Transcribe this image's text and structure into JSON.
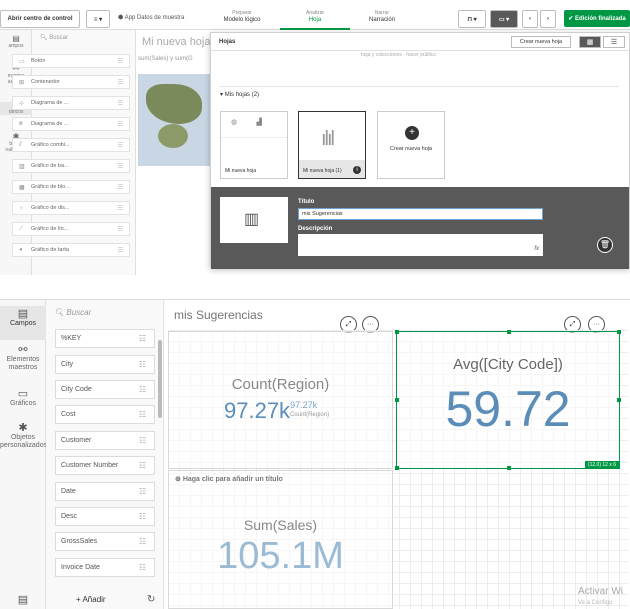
{
  "toolbar": {
    "hub_button": "Abrir centro de control",
    "app_name": "App Datos de muestra",
    "modes": [
      {
        "small": "Preparar",
        "main": "Modelo lógico"
      },
      {
        "small": "Analizar",
        "main": "Hoja"
      },
      {
        "small": "Narrar",
        "main": "Narración"
      }
    ],
    "done_button": "Edición finalizada"
  },
  "left_icons_top": [
    "ampos",
    "mentos aestros",
    "ráficos",
    "bjetos nalizados"
  ],
  "assets_top": {
    "search_placeholder": "Buscar",
    "items": [
      "Botón",
      "Contenedor",
      "Diagrama de ...",
      "Diagrama de ...",
      "Gráfico combi...",
      "Gráfico de ba...",
      "Gráfico de blo...",
      "Gráfico de dis...",
      "Gráfico de lín...",
      "Gráfico de tarta"
    ]
  },
  "bg_sheet": {
    "title": "Mi nueva hoja",
    "subtitle": "sum(Sales) y sum(G"
  },
  "sheets_dialog": {
    "title": "Hojas",
    "create_button": "Crear nueva hoja",
    "faint_text": "hoja y colecciones - hacer público",
    "section_label": "Mis hojas (2)",
    "cards": [
      {
        "label": "Mi nueva hoja"
      },
      {
        "label": "Mi nueva hoja (1)"
      },
      {
        "label": "Crear nueva hoja"
      }
    ],
    "title_label": "Título",
    "title_value": "mis Sugerencias",
    "description_label": "Descripción",
    "fx": "fx"
  },
  "fields_panel": {
    "search_placeholder": "Buscar",
    "fields": [
      "%KEY",
      "City",
      "City Code",
      "Cost",
      "Customer",
      "Customer Number",
      "Date",
      "Desc",
      "GrossSales",
      "Invoice Date"
    ],
    "add_label": "Añadir"
  },
  "nav": [
    {
      "label": "Campos",
      "icon": "database-icon"
    },
    {
      "label": "Elementos maestros",
      "icon": "link-icon"
    },
    {
      "label": "Gráficos",
      "icon": "chart-icon"
    },
    {
      "label": "Objetos personalizados",
      "icon": "puzzle-icon"
    }
  ],
  "sheet": {
    "title": "mis Sugerencias",
    "kpi1": {
      "label": "Count(Region)",
      "value": "97.27k",
      "sup": "97.27k",
      "sub": "Count(Region)"
    },
    "kpi2": {
      "label": "Avg([City Code])",
      "value": "59.72",
      "size": "(12,0) 12 x 6"
    },
    "kpi3": {
      "hint": "Haga clic para añadir un título",
      "label": "Sum(Sales)",
      "value": "105.1M"
    }
  },
  "watermark": {
    "line1": "Activar Wi",
    "line2": "Ve a Configu"
  },
  "colors": {
    "accent": "#009845",
    "kpi_value": "#5b8db8",
    "dark_panel": "#595959"
  }
}
